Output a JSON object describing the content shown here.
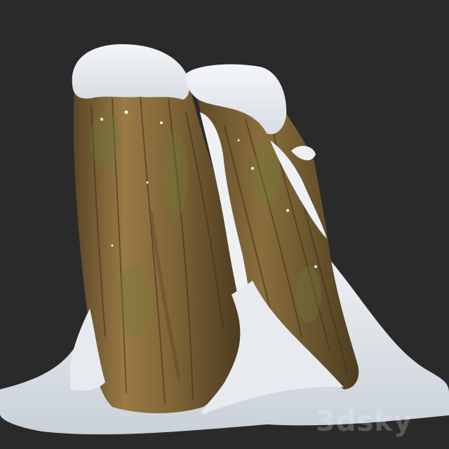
{
  "scene": {
    "subject": "snow-covered-tree-stump",
    "colors": {
      "background": "#2a2a2b",
      "bark_light": "#9a7a45",
      "bark_mid": "#6e5a30",
      "bark_dark": "#3d2f1a",
      "moss": "#6f7a3a",
      "snow": "#eef1f4",
      "snow_shadow": "#c9d0d8"
    }
  },
  "watermark": {
    "text": "3dsky"
  }
}
